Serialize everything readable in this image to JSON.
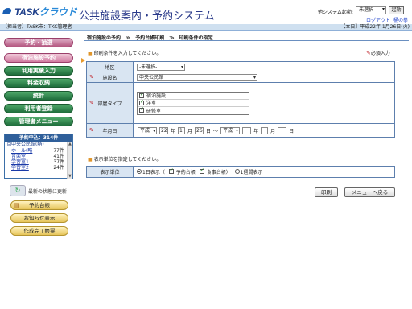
{
  "header": {
    "logo": {
      "main": "TASK",
      "sub": "クラウド"
    },
    "app_title": "公共施設案内・予約システム",
    "other_system_label": "他システム起動:",
    "other_system_value": "-未選択-",
    "launch_button": "起動",
    "logout_link": "ログアウト",
    "help_link": "桶の拳"
  },
  "topbar": {
    "user": "【担当者】TASK市：TKC管理者",
    "today": "【本日】平成22年 1月26日(火)"
  },
  "sidebar": {
    "nav": [
      {
        "label": "予約・抽選",
        "style": "pink"
      },
      {
        "label": "宿泊施設予約",
        "style": "active"
      },
      {
        "label": "利用実績入力",
        "style": "green"
      },
      {
        "label": "料金収納",
        "style": "green"
      },
      {
        "label": "統計",
        "style": "green"
      },
      {
        "label": "利用者登録",
        "style": "green"
      },
      {
        "label": "管理者メニュー",
        "style": "green"
      }
    ],
    "summary": {
      "title": "予約申込：314件",
      "group": "中央公民館(略)",
      "rows": [
        {
          "name": "ホール(略",
          "count": "77件"
        },
        {
          "name": "音楽室",
          "count": "41件"
        },
        {
          "name": "学習室1",
          "count": "37件"
        },
        {
          "name": "学習室2",
          "count": "24件"
        }
      ]
    },
    "refresh_label": "最新の状態に更新",
    "buttons": [
      "予約台帳",
      "お知らせ表示",
      "作成完了帳票"
    ]
  },
  "main": {
    "breadcrumb": "宿泊施設の予約　≫　予約台帳印刷　≫　印刷条件の指定",
    "instruction1": "印刷条件を入力してください。",
    "required_label": "必須入力",
    "fields": {
      "area_label": "地区",
      "area_value": "-未選択-",
      "facility_label": "施設名",
      "facility_value": "中央公民館",
      "room_type_label": "部屋タイプ",
      "room_types": [
        {
          "label": "宿泊施設",
          "checked": true
        },
        {
          "label": "洋室",
          "checked": true
        },
        {
          "label": "研修室",
          "checked": true
        }
      ],
      "date_label": "年月日",
      "era_from": "平成",
      "year_from": "22",
      "year_unit": "年",
      "month_from": "1",
      "month_unit": "月",
      "day_from": "26",
      "day_unit": "日",
      "range_sep": "～",
      "era_to": "平成",
      "year_to": "",
      "month_to": "",
      "day_to": ""
    },
    "instruction2": "表示単位を指定してください。",
    "display_unit_label": "表示単位",
    "display_units": [
      {
        "label": "1日表示（",
        "selected": true
      },
      {
        "label": "予約台帳",
        "selected": true
      },
      {
        "label": "食事台帳）",
        "selected": true
      },
      {
        "label": "1週間表示",
        "selected": false
      }
    ],
    "print_button": "印刷",
    "back_button": "メニューへ戻る"
  }
}
